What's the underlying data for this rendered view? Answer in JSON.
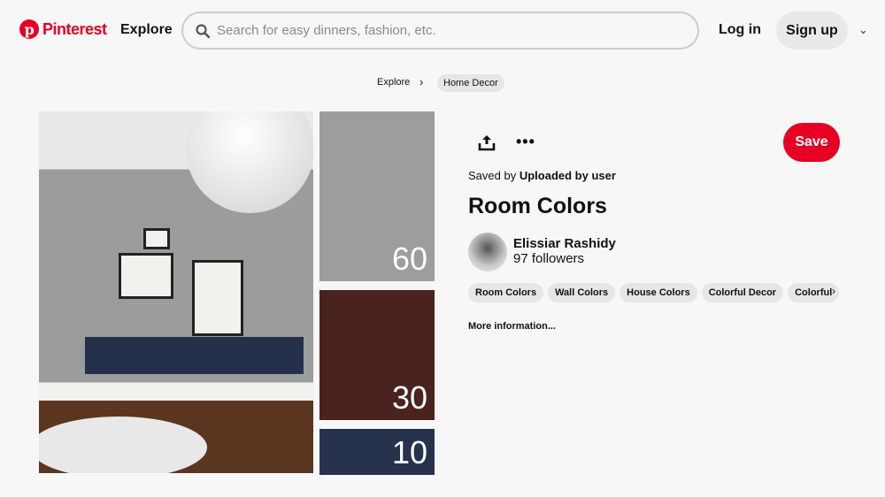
{
  "header": {
    "logo_text": "Pinterest",
    "explore_label": "Explore",
    "search_placeholder": "Search for easy dinners, fashion, etc.",
    "login_label": "Log in",
    "signup_label": "Sign up"
  },
  "breadcrumb": [
    "Explore",
    "Home Decor"
  ],
  "pin": {
    "swatches": [
      {
        "label": "60",
        "color": "#9d9d9b"
      },
      {
        "label": "30",
        "color": "#4a221e"
      },
      {
        "label": "10",
        "color": "#27324d"
      }
    ],
    "save_label": "Save",
    "saved_by_prefix": "Saved by",
    "saved_by": "Uploaded by user",
    "title": "Room Colors",
    "author": "Elissiar Rashidy",
    "followers": "97 followers",
    "tags": [
      "Room Colors",
      "Wall Colors",
      "House Colors",
      "Colorful Decor",
      "Colorful"
    ],
    "more_info": "More information..."
  },
  "colors": {
    "brand": "#e60023"
  }
}
